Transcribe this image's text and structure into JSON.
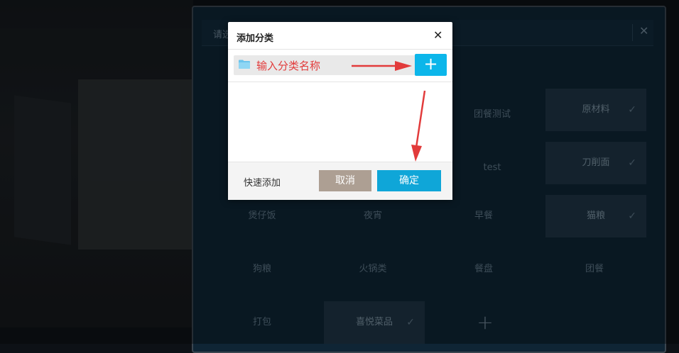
{
  "background": {
    "footer_text": "—□ □□"
  },
  "panel": {
    "title": "请选",
    "close_icon": "close-icon",
    "top_partial_label": "",
    "categories": [
      {
        "label": "团餐测试",
        "selected": false
      },
      {
        "label": "原材料",
        "selected": true
      },
      {
        "label": "test",
        "selected": false
      },
      {
        "label": "刀削面",
        "selected": true
      },
      {
        "label": "煲仔饭",
        "selected": false
      },
      {
        "label": "夜宵",
        "selected": false
      },
      {
        "label": "早餐",
        "selected": false
      },
      {
        "label": "猫粮",
        "selected": true
      },
      {
        "label": "狗粮",
        "selected": false
      },
      {
        "label": "火锅类",
        "selected": false
      },
      {
        "label": "餐盘",
        "selected": false
      },
      {
        "label": "团餐",
        "selected": false
      },
      {
        "label": "打包",
        "selected": false
      },
      {
        "label": "喜悦菜品",
        "selected": true
      }
    ],
    "check_glyph": "✓",
    "add_glyph": "+"
  },
  "dialog": {
    "title": "添加分类",
    "close_glyph": "✕",
    "input_placeholder": "输入分类名称",
    "input_value": "",
    "add_glyph": "+",
    "quick_add": "快速添加",
    "cancel": "取消",
    "confirm": "确定"
  },
  "colors": {
    "accent": "#0cb6ea",
    "confirm": "#0fa6d8",
    "cancel": "#ad9f93",
    "annotation": "#e23b3b",
    "panel_bg": "#0f2535"
  }
}
